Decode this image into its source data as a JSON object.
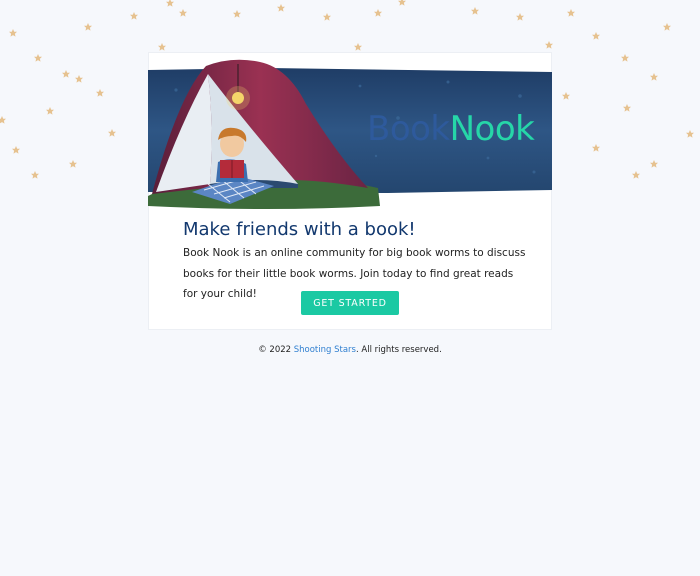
{
  "brand": {
    "name_part1": "Book",
    "name_part2": "Nook",
    "color_part1": "#2e5a9c",
    "color_part2": "#26d6a8"
  },
  "card": {
    "headline": "Make friends with a book!",
    "body": "Book Nook is an online community for big book worms to discuss books for their little book worms. Join today to find great reads for your child!",
    "cta_label": "GET STARTED",
    "cta_color": "#1bc9a3"
  },
  "footer": {
    "copyright": "© 2022",
    "link_text": "Shooting Stars",
    "suffix": ". All rights reserved.",
    "link_color": "#2f7fd0"
  },
  "colors": {
    "page_background": "#f6f8fc",
    "star": "#e6c290",
    "banner_night": "#24466f"
  }
}
